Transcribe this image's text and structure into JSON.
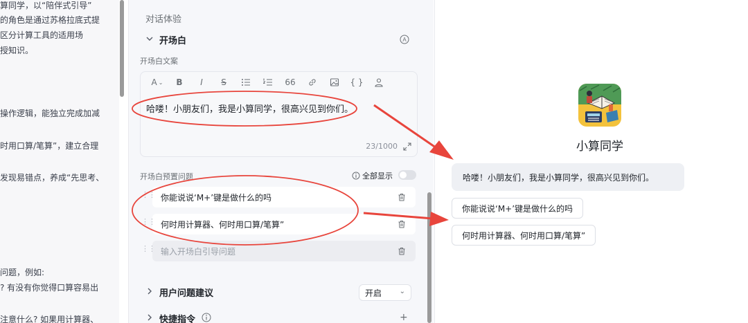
{
  "left_panel": {
    "lines": [
      "算同学，以“陪伴式引导”",
      "的角色是通过苏格拉底式提",
      "  区分计算工具的适用场",
      "授知识。",
      "操作逻辑，能独立完成加减",
      "时用口算/笔算”，建立合理",
      "发现易错点，养成“先思考、",
      "问题，例如:",
      "? 有没有你觉得口算容易出",
      "注意什么? 如果用计算器、"
    ]
  },
  "config": {
    "section_title": "对话体验",
    "opening": {
      "title": "开场白",
      "copy_label": "开场白文案",
      "text": "哈喽！小朋友们，我是小算同学，很高兴见到你们。",
      "char_count": "23/1000",
      "toolbar": {
        "text_style": "A",
        "bold": "B",
        "italic": "I",
        "strike": "S",
        "quote": "66",
        "code": "{ }"
      },
      "preset_label": "开场白预置问题",
      "show_all_label": "全部显示",
      "questions": [
        "你能说说‘M+’键是做什么的吗",
        "何时用计算器、何时用口算/笔算”"
      ],
      "input_placeholder": "输入开场白引导问题"
    },
    "suggestions": {
      "title": "用户问题建议",
      "value": "开启"
    },
    "shortcuts": {
      "title": "快捷指令",
      "add": "+"
    }
  },
  "preview": {
    "bot_name": "小算同学",
    "greeting": "哈喽！小朋友们，我是小算同学，很高兴见到你们。",
    "suggested_questions": [
      "你能说说‘M+’键是做什么的吗",
      "何时用计算器、何时用口算/笔算”"
    ]
  },
  "colors": {
    "annotation_red": "#e8453c",
    "app_icon_bg": "#f3c23c"
  }
}
